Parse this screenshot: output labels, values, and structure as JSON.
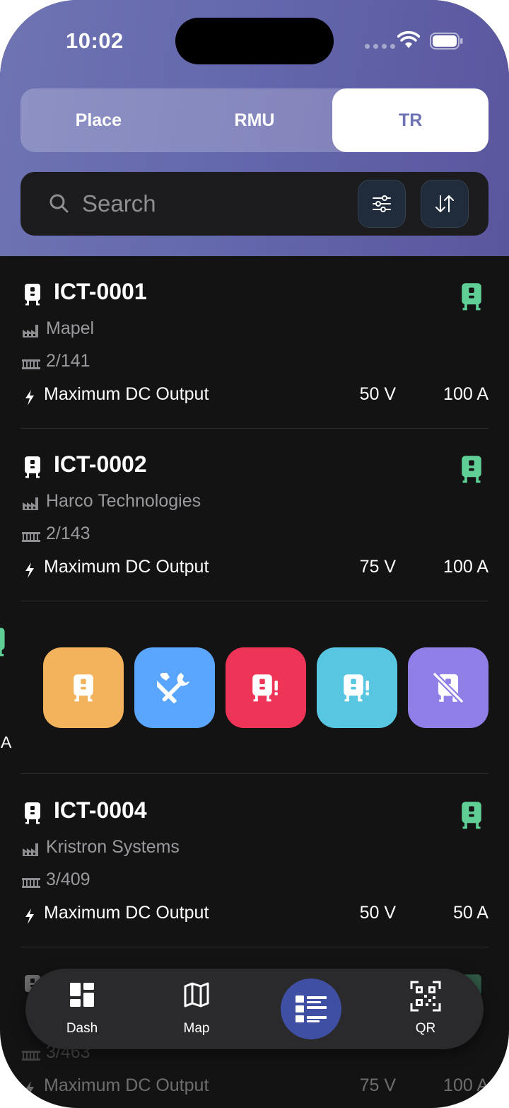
{
  "status_bar": {
    "time": "10:02"
  },
  "segments": [
    {
      "label": "Place",
      "active": false
    },
    {
      "label": "RMU",
      "active": false
    },
    {
      "label": "TR",
      "active": true
    }
  ],
  "search": {
    "placeholder": "Search"
  },
  "items": [
    {
      "id": "ICT-0001",
      "manufacturer": "Mapel",
      "location": "2/141",
      "dc_label": "Maximum DC Output",
      "voltage": "50 V",
      "current": "100 A"
    },
    {
      "id": "ICT-0002",
      "manufacturer": "Harco Technologies",
      "location": "2/143",
      "dc_label": "Maximum DC Output",
      "voltage": "75 V",
      "current": "100 A"
    },
    {
      "id": "ICT-0004",
      "manufacturer": "Kristron Systems",
      "location": "3/409",
      "dc_label": "Maximum DC Output",
      "voltage": "50 V",
      "current": "50 A"
    },
    {
      "id": "",
      "manufacturer": "",
      "location": "3/463",
      "dc_label": "Maximum DC Output",
      "voltage": "75 V",
      "current": "100 A"
    }
  ],
  "swipe_row": {
    "peek_text": "A"
  },
  "swipe_actions": [
    {
      "icon": "transformer-icon",
      "color": "#f3b35c"
    },
    {
      "icon": "tools-icon",
      "color": "#5aa6ff"
    },
    {
      "icon": "transformer-alert-icon",
      "color": "#ee3557"
    },
    {
      "icon": "transformer-warning-icon",
      "color": "#58c6e0"
    },
    {
      "icon": "transformer-disabled-icon",
      "color": "#8f7fe6"
    }
  ],
  "colors": {
    "status_green": "#5fcf96",
    "accent": "#3f4fa3"
  },
  "tabbar": {
    "tabs": [
      {
        "label": "Dash",
        "icon": "dashboard-icon"
      },
      {
        "label": "Map",
        "icon": "map-icon"
      },
      {
        "label": "",
        "icon": "list-icon",
        "active": true
      },
      {
        "label": "QR",
        "icon": "qr-icon"
      }
    ]
  }
}
